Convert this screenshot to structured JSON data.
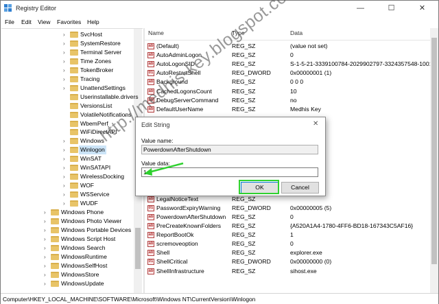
{
  "window": {
    "title": "Registry Editor",
    "minimize_glyph": "—",
    "maximize_glyph": "☐",
    "close_glyph": "✕"
  },
  "menu": [
    "File",
    "Edit",
    "View",
    "Favorites",
    "Help"
  ],
  "tree": {
    "items": [
      {
        "label": "SvcHost",
        "expand": true
      },
      {
        "label": "SystemRestore",
        "expand": true
      },
      {
        "label": "Terminal Server",
        "expand": true
      },
      {
        "label": "Time Zones",
        "expand": true
      },
      {
        "label": "TokenBroker",
        "expand": true
      },
      {
        "label": "Tracing",
        "expand": true
      },
      {
        "label": "UnattendSettings",
        "expand": true
      },
      {
        "label": "Userinstallable.drivers",
        "expand": false
      },
      {
        "label": "VersionsList",
        "expand": false
      },
      {
        "label": "VolatileNotifications",
        "expand": false
      },
      {
        "label": "WbemPerf",
        "expand": false
      },
      {
        "label": "WiFiDirectAPI",
        "expand": false
      },
      {
        "label": "Windows",
        "expand": true
      },
      {
        "label": "Winlogon",
        "expand": true,
        "selected": true
      },
      {
        "label": "WinSAT",
        "expand": true
      },
      {
        "label": "WinSATAPI",
        "expand": true
      },
      {
        "label": "WirelessDocking",
        "expand": true
      },
      {
        "label": "WOF",
        "expand": true
      },
      {
        "label": "WSService",
        "expand": true
      },
      {
        "label": "WUDF",
        "expand": true
      },
      {
        "label": "Windows Phone",
        "expand": true,
        "level": 0
      },
      {
        "label": "Windows Photo Viewer",
        "expand": true,
        "level": 0
      },
      {
        "label": "Windows Portable Devices",
        "expand": true,
        "level": 0
      },
      {
        "label": "Windows Script Host",
        "expand": true,
        "level": 0
      },
      {
        "label": "Windows Search",
        "expand": true,
        "level": 0
      },
      {
        "label": "WindowsRuntime",
        "expand": true,
        "level": 0
      },
      {
        "label": "WindowsSelfHost",
        "expand": true,
        "level": 0
      },
      {
        "label": "WindowsStore",
        "expand": true,
        "level": 0
      },
      {
        "label": "WindowsUpdate",
        "expand": true,
        "level": 0
      }
    ]
  },
  "list": {
    "headers": {
      "name": "Name",
      "type": "Type",
      "data": "Data"
    },
    "rows": [
      {
        "name": "(Default)",
        "type": "REG_SZ",
        "data": "(value not set)"
      },
      {
        "name": "AutoAdminLogon",
        "type": "REG_SZ",
        "data": "0"
      },
      {
        "name": "AutoLogonSID",
        "type": "REG_SZ",
        "data": "S-1-5-21-3339100784-2029902797-3324357548-1001"
      },
      {
        "name": "AutoRestartShell",
        "type": "REG_DWORD",
        "data": "0x00000001 (1)"
      },
      {
        "name": "Background",
        "type": "REG_SZ",
        "data": "0 0 0"
      },
      {
        "name": "CachedLogonsCount",
        "type": "REG_SZ",
        "data": "10"
      },
      {
        "name": "DebugServerCommand",
        "type": "REG_SZ",
        "data": "no"
      },
      {
        "name": "DefaultUserName",
        "type": "REG_SZ",
        "data": "Medhis Key"
      },
      {
        "name": "",
        "type": "",
        "data": "",
        "hidden": true
      },
      {
        "name": "",
        "type": "",
        "data": "",
        "hidden": true
      },
      {
        "name": "",
        "type": "",
        "data": "",
        "hidden": true
      },
      {
        "name": "",
        "type": "",
        "data": "",
        "hidden": true
      },
      {
        "name": "",
        "type": "",
        "data": "",
        "hidden": true
      },
      {
        "name": "",
        "type": "",
        "data": "",
        "hidden": true
      },
      {
        "name": "",
        "type": "",
        "data": "",
        "hidden": true
      },
      {
        "name": "",
        "type": "",
        "data": "",
        "hidden": true
      },
      {
        "name": "",
        "type": "",
        "data": "",
        "hidden": true
      },
      {
        "name": "LegalNoticeText",
        "type": "REG_SZ",
        "data": ""
      },
      {
        "name": "PasswordExpiryWarning",
        "type": "REG_DWORD",
        "data": "0x00000005 (5)"
      },
      {
        "name": "PowerdownAfterShutdown",
        "type": "REG_SZ",
        "data": "0"
      },
      {
        "name": "PreCreateKnownFolders",
        "type": "REG_SZ",
        "data": "{A520A1A4-1780-4FF6-BD18-167343C5AF16}"
      },
      {
        "name": "ReportBootOk",
        "type": "REG_SZ",
        "data": "1"
      },
      {
        "name": "scremoveoption",
        "type": "REG_SZ",
        "data": "0"
      },
      {
        "name": "Shell",
        "type": "REG_SZ",
        "data": "explorer.exe"
      },
      {
        "name": "ShellCritical",
        "type": "REG_DWORD",
        "data": "0x00000000 (0)"
      },
      {
        "name": "ShellInfrastructure",
        "type": "REG_SZ",
        "data": "sihost.exe"
      }
    ]
  },
  "status": {
    "path": "Computer\\HKEY_LOCAL_MACHINE\\SOFTWARE\\Microsoft\\Windows NT\\CurrentVersion\\Winlogon"
  },
  "dialog": {
    "title": "Edit String",
    "close_glyph": "✕",
    "value_name_label": "Value name:",
    "value_name": "PowerdownAfterShutdown",
    "value_data_label": "Value data:",
    "value_data": "1",
    "ok_label": "OK",
    "cancel_label": "Cancel"
  },
  "watermark": "http://medhis-key.blogspot.com",
  "colors": {
    "highlight": "#2ed12e",
    "selection": "#cce4f7",
    "folder": "#e8c468"
  }
}
